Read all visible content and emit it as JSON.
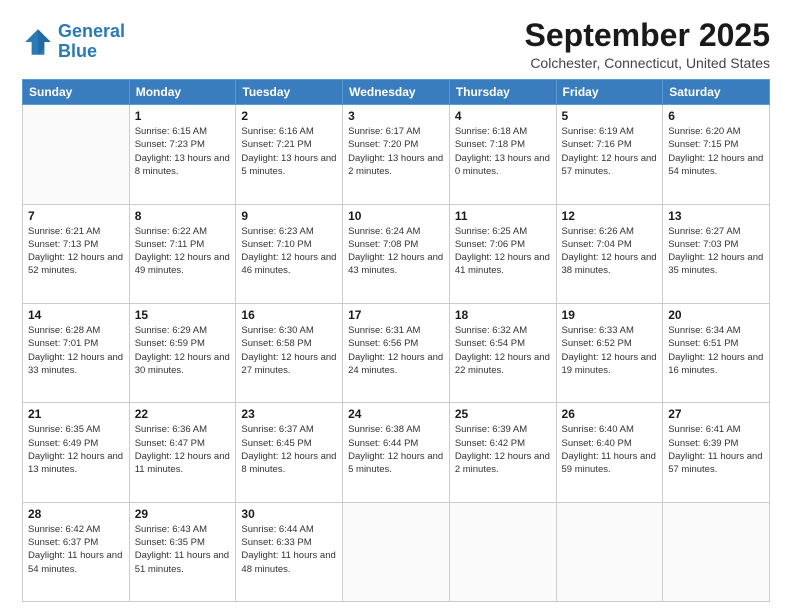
{
  "logo": {
    "line1": "General",
    "line2": "Blue"
  },
  "title": "September 2025",
  "location": "Colchester, Connecticut, United States",
  "weekdays": [
    "Sunday",
    "Monday",
    "Tuesday",
    "Wednesday",
    "Thursday",
    "Friday",
    "Saturday"
  ],
  "weeks": [
    [
      {
        "day": "",
        "sunrise": "",
        "sunset": "",
        "daylight": ""
      },
      {
        "day": "1",
        "sunrise": "Sunrise: 6:15 AM",
        "sunset": "Sunset: 7:23 PM",
        "daylight": "Daylight: 13 hours and 8 minutes."
      },
      {
        "day": "2",
        "sunrise": "Sunrise: 6:16 AM",
        "sunset": "Sunset: 7:21 PM",
        "daylight": "Daylight: 13 hours and 5 minutes."
      },
      {
        "day": "3",
        "sunrise": "Sunrise: 6:17 AM",
        "sunset": "Sunset: 7:20 PM",
        "daylight": "Daylight: 13 hours and 2 minutes."
      },
      {
        "day": "4",
        "sunrise": "Sunrise: 6:18 AM",
        "sunset": "Sunset: 7:18 PM",
        "daylight": "Daylight: 13 hours and 0 minutes."
      },
      {
        "day": "5",
        "sunrise": "Sunrise: 6:19 AM",
        "sunset": "Sunset: 7:16 PM",
        "daylight": "Daylight: 12 hours and 57 minutes."
      },
      {
        "day": "6",
        "sunrise": "Sunrise: 6:20 AM",
        "sunset": "Sunset: 7:15 PM",
        "daylight": "Daylight: 12 hours and 54 minutes."
      }
    ],
    [
      {
        "day": "7",
        "sunrise": "Sunrise: 6:21 AM",
        "sunset": "Sunset: 7:13 PM",
        "daylight": "Daylight: 12 hours and 52 minutes."
      },
      {
        "day": "8",
        "sunrise": "Sunrise: 6:22 AM",
        "sunset": "Sunset: 7:11 PM",
        "daylight": "Daylight: 12 hours and 49 minutes."
      },
      {
        "day": "9",
        "sunrise": "Sunrise: 6:23 AM",
        "sunset": "Sunset: 7:10 PM",
        "daylight": "Daylight: 12 hours and 46 minutes."
      },
      {
        "day": "10",
        "sunrise": "Sunrise: 6:24 AM",
        "sunset": "Sunset: 7:08 PM",
        "daylight": "Daylight: 12 hours and 43 minutes."
      },
      {
        "day": "11",
        "sunrise": "Sunrise: 6:25 AM",
        "sunset": "Sunset: 7:06 PM",
        "daylight": "Daylight: 12 hours and 41 minutes."
      },
      {
        "day": "12",
        "sunrise": "Sunrise: 6:26 AM",
        "sunset": "Sunset: 7:04 PM",
        "daylight": "Daylight: 12 hours and 38 minutes."
      },
      {
        "day": "13",
        "sunrise": "Sunrise: 6:27 AM",
        "sunset": "Sunset: 7:03 PM",
        "daylight": "Daylight: 12 hours and 35 minutes."
      }
    ],
    [
      {
        "day": "14",
        "sunrise": "Sunrise: 6:28 AM",
        "sunset": "Sunset: 7:01 PM",
        "daylight": "Daylight: 12 hours and 33 minutes."
      },
      {
        "day": "15",
        "sunrise": "Sunrise: 6:29 AM",
        "sunset": "Sunset: 6:59 PM",
        "daylight": "Daylight: 12 hours and 30 minutes."
      },
      {
        "day": "16",
        "sunrise": "Sunrise: 6:30 AM",
        "sunset": "Sunset: 6:58 PM",
        "daylight": "Daylight: 12 hours and 27 minutes."
      },
      {
        "day": "17",
        "sunrise": "Sunrise: 6:31 AM",
        "sunset": "Sunset: 6:56 PM",
        "daylight": "Daylight: 12 hours and 24 minutes."
      },
      {
        "day": "18",
        "sunrise": "Sunrise: 6:32 AM",
        "sunset": "Sunset: 6:54 PM",
        "daylight": "Daylight: 12 hours and 22 minutes."
      },
      {
        "day": "19",
        "sunrise": "Sunrise: 6:33 AM",
        "sunset": "Sunset: 6:52 PM",
        "daylight": "Daylight: 12 hours and 19 minutes."
      },
      {
        "day": "20",
        "sunrise": "Sunrise: 6:34 AM",
        "sunset": "Sunset: 6:51 PM",
        "daylight": "Daylight: 12 hours and 16 minutes."
      }
    ],
    [
      {
        "day": "21",
        "sunrise": "Sunrise: 6:35 AM",
        "sunset": "Sunset: 6:49 PM",
        "daylight": "Daylight: 12 hours and 13 minutes."
      },
      {
        "day": "22",
        "sunrise": "Sunrise: 6:36 AM",
        "sunset": "Sunset: 6:47 PM",
        "daylight": "Daylight: 12 hours and 11 minutes."
      },
      {
        "day": "23",
        "sunrise": "Sunrise: 6:37 AM",
        "sunset": "Sunset: 6:45 PM",
        "daylight": "Daylight: 12 hours and 8 minutes."
      },
      {
        "day": "24",
        "sunrise": "Sunrise: 6:38 AM",
        "sunset": "Sunset: 6:44 PM",
        "daylight": "Daylight: 12 hours and 5 minutes."
      },
      {
        "day": "25",
        "sunrise": "Sunrise: 6:39 AM",
        "sunset": "Sunset: 6:42 PM",
        "daylight": "Daylight: 12 hours and 2 minutes."
      },
      {
        "day": "26",
        "sunrise": "Sunrise: 6:40 AM",
        "sunset": "Sunset: 6:40 PM",
        "daylight": "Daylight: 11 hours and 59 minutes."
      },
      {
        "day": "27",
        "sunrise": "Sunrise: 6:41 AM",
        "sunset": "Sunset: 6:39 PM",
        "daylight": "Daylight: 11 hours and 57 minutes."
      }
    ],
    [
      {
        "day": "28",
        "sunrise": "Sunrise: 6:42 AM",
        "sunset": "Sunset: 6:37 PM",
        "daylight": "Daylight: 11 hours and 54 minutes."
      },
      {
        "day": "29",
        "sunrise": "Sunrise: 6:43 AM",
        "sunset": "Sunset: 6:35 PM",
        "daylight": "Daylight: 11 hours and 51 minutes."
      },
      {
        "day": "30",
        "sunrise": "Sunrise: 6:44 AM",
        "sunset": "Sunset: 6:33 PM",
        "daylight": "Daylight: 11 hours and 48 minutes."
      },
      {
        "day": "",
        "sunrise": "",
        "sunset": "",
        "daylight": ""
      },
      {
        "day": "",
        "sunrise": "",
        "sunset": "",
        "daylight": ""
      },
      {
        "day": "",
        "sunrise": "",
        "sunset": "",
        "daylight": ""
      },
      {
        "day": "",
        "sunrise": "",
        "sunset": "",
        "daylight": ""
      }
    ]
  ]
}
